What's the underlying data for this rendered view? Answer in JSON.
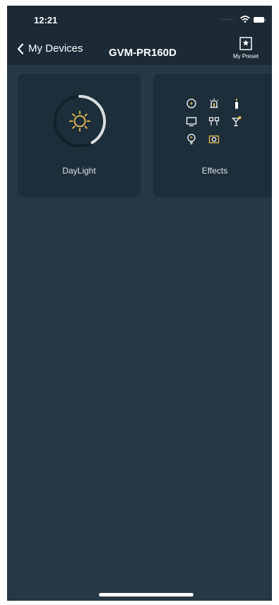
{
  "status_bar": {
    "time": "12:21",
    "signal_dots": "....."
  },
  "nav": {
    "back_label": "My Devices",
    "title": "GVM-PR160D",
    "preset_label": "My Preset"
  },
  "tiles": [
    {
      "label": "DayLight",
      "icon": "sun-icon"
    },
    {
      "label": "Effects",
      "icon": "effects-grid"
    }
  ],
  "colors": {
    "background": "#253844",
    "header": "#1b2a35",
    "tile": "#1c2e3a",
    "accent_yellow": "#f2c14e",
    "text": "#ffffff"
  }
}
